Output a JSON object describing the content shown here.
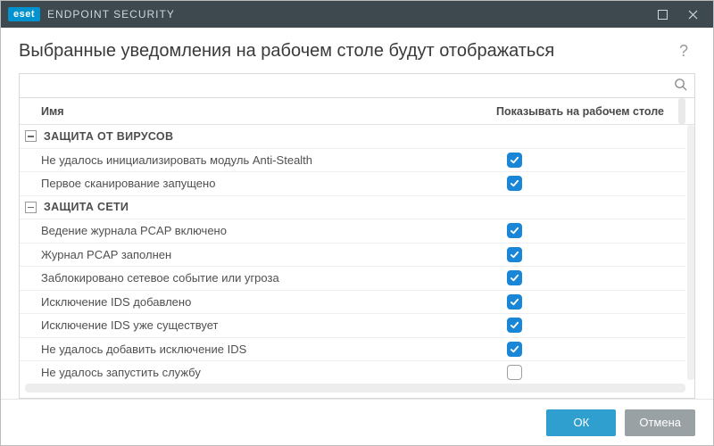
{
  "titlebar": {
    "brand_badge": "eset",
    "product": "ENDPOINT SECURITY"
  },
  "header": {
    "page_title": "Выбранные уведомления на рабочем столе будут отображаться",
    "help_symbol": "?"
  },
  "search": {
    "placeholder": ""
  },
  "table": {
    "columns": {
      "name": "Имя",
      "show_on_desktop": "Показывать на рабочем столе"
    },
    "groups": [
      {
        "label": "ЗАЩИТА ОТ ВИРУСОВ",
        "expanded": true,
        "items": [
          {
            "name": "Не удалось инициализировать модуль Anti-Stealth",
            "checked": true
          },
          {
            "name": "Первое сканирование запущено",
            "checked": true
          }
        ]
      },
      {
        "label": "ЗАЩИТА СЕТИ",
        "expanded": true,
        "items": [
          {
            "name": "Ведение журнала PCAP включено",
            "checked": true
          },
          {
            "name": "Журнал PCAP заполнен",
            "checked": true
          },
          {
            "name": "Заблокировано сетевое событие или угроза",
            "checked": true
          },
          {
            "name": "Исключение IDS добавлено",
            "checked": true
          },
          {
            "name": "Исключение IDS уже существует",
            "checked": true
          },
          {
            "name": "Не удалось добавить исключение IDS",
            "checked": true
          },
          {
            "name": "Не удалось запустить службу",
            "checked": false
          }
        ]
      }
    ]
  },
  "footer": {
    "ok": "ОК",
    "cancel": "Отмена"
  }
}
